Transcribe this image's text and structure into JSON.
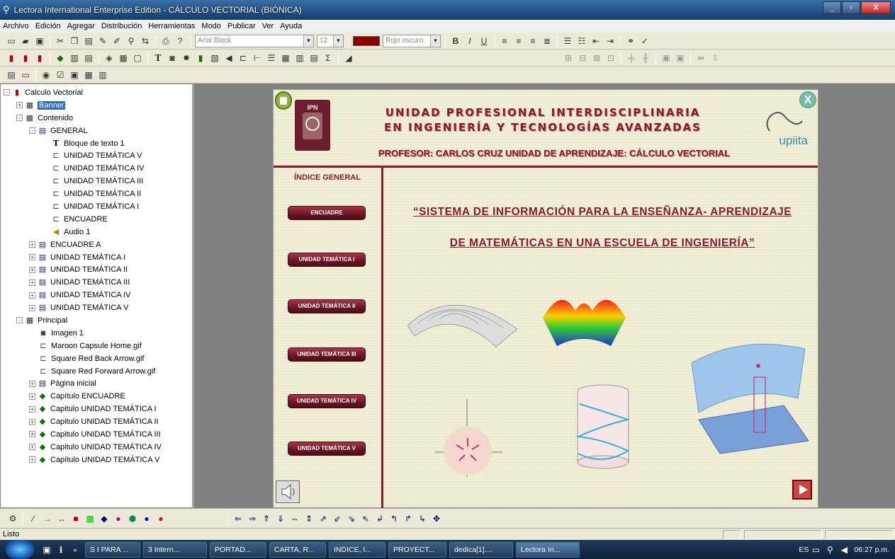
{
  "window": {
    "title": "Lectora International Enterprise Edition - CÁLCULO  VECTORIAL (BIÓNICA)"
  },
  "menu": [
    "Archivo",
    "Edición",
    "Agregar",
    "Distribución",
    "Herramientas",
    "Modo",
    "Publicar",
    "Ver",
    "Ayuda"
  ],
  "toolbar": {
    "font": "Arial Black",
    "size": "12",
    "color_name": "Rojo oscuro",
    "color": "#8b0000"
  },
  "tree": [
    {
      "label": "Calculo Vectorial",
      "level": 0,
      "icon": "book-icon",
      "exp": "-"
    },
    {
      "label": "Banner",
      "level": 1,
      "icon": "frame-icon",
      "exp": "+",
      "selected": true
    },
    {
      "label": "Contenido",
      "level": 1,
      "icon": "frame-icon",
      "exp": "-"
    },
    {
      "label": "GENERAL",
      "level": 2,
      "icon": "page-icon",
      "exp": "-"
    },
    {
      "label": "Bloque de texto 1",
      "level": 3,
      "icon": "text-icon"
    },
    {
      "label": "UNIDAD TEMÁTICA V",
      "level": 3,
      "icon": "button-icon"
    },
    {
      "label": "UNIDAD TEMÁTICA IV",
      "level": 3,
      "icon": "button-icon"
    },
    {
      "label": "UNIDAD TEMÁTICA III",
      "level": 3,
      "icon": "button-icon"
    },
    {
      "label": "UNIDAD TEMÁTICA II",
      "level": 3,
      "icon": "button-icon"
    },
    {
      "label": "UNIDAD TEMÁTICA I",
      "level": 3,
      "icon": "button-icon"
    },
    {
      "label": "ENCUADRE",
      "level": 3,
      "icon": "button-icon"
    },
    {
      "label": "Audio 1",
      "level": 3,
      "icon": "audio-icon"
    },
    {
      "label": "ENCUADRE A",
      "level": 2,
      "icon": "page-icon",
      "exp": "+"
    },
    {
      "label": "UNIDAD TEMÁTICA I",
      "level": 2,
      "icon": "page-icon",
      "exp": "+"
    },
    {
      "label": "UNIDAD TEMÁTICA II",
      "level": 2,
      "icon": "page-icon",
      "exp": "+"
    },
    {
      "label": "UNIDAD TEMÁTICA III",
      "level": 2,
      "icon": "page-icon",
      "exp": "+"
    },
    {
      "label": "UNIDAD TEMÁTICA IV",
      "level": 2,
      "icon": "page-icon",
      "exp": "+"
    },
    {
      "label": "UNIDAD TEMÁTICA V",
      "level": 2,
      "icon": "page-icon",
      "exp": "+"
    },
    {
      "label": "Principal",
      "level": 1,
      "icon": "frame-icon",
      "exp": "-"
    },
    {
      "label": "Imagen 1",
      "level": 2,
      "icon": "image-icon"
    },
    {
      "label": "Maroon Capsule Home.gif",
      "level": 2,
      "icon": "button-icon"
    },
    {
      "label": "Square Red Back Arrow.gif",
      "level": 2,
      "icon": "button-icon"
    },
    {
      "label": "Square Red  Forward Arrow.gif",
      "level": 2,
      "icon": "button-icon"
    },
    {
      "label": "Página inicial",
      "level": 2,
      "icon": "page-icon",
      "exp": "+"
    },
    {
      "label": "Capítulo ENCUADRE",
      "level": 2,
      "icon": "chapter-icon",
      "exp": "+"
    },
    {
      "label": "Capitulo UNIDAD TEMÁTICA I",
      "level": 2,
      "icon": "chapter-icon",
      "exp": "+"
    },
    {
      "label": "Capitulo UNIDAD TEMÁTICA II",
      "level": 2,
      "icon": "chapter-icon",
      "exp": "+"
    },
    {
      "label": "Capitulo UNIDAD TEMÁTICA III",
      "level": 2,
      "icon": "chapter-icon",
      "exp": "+"
    },
    {
      "label": "Capitulo UNIDAD TEMÁTICA IV",
      "level": 2,
      "icon": "chapter-icon",
      "exp": "+"
    },
    {
      "label": "Capítulo UNIDAD TEMÁTICA V",
      "level": 2,
      "icon": "chapter-icon",
      "exp": "+"
    }
  ],
  "page": {
    "header_line1": "UNIDAD PROFESIONAL INTERDISCIPLINARIA",
    "header_line2": "EN INGENIERÍA Y TECNOLOGÍAS AVANZADAS",
    "professor": "PROFESOR:  CARLOS CRUZ    UNIDAD  DE  APRENDIZAJE:   CÁLCULO VECTORIAL",
    "seal": "IPN",
    "logo": "upiita",
    "index_title": "ÍNDICE GENERAL",
    "nav_buttons": [
      "ENCUADRE",
      "UNIDAD TEMÁTICA I",
      "UNIDAD TEMÁTICA II",
      "UNIDAD TEMÁTICA III",
      "UNIDAD TEMÁTICA IV",
      "UNIDAD TEMÁTICA V"
    ],
    "title_line1": "“SISTEMA  DE  INFORMACIÓN PARA LA ENSEÑANZA- APRENDIZAJE",
    "title_line2": "DE MATEMÁTICAS   EN   UNA   ESCUELA   DE   INGENIERÍA”",
    "close_label": "X"
  },
  "status": {
    "text": "Listo"
  },
  "taskbar": {
    "tasks": [
      "S I PARA ...",
      "3 Intern...",
      "PORTAD...",
      "CARTA, R...",
      "INDICE, I...",
      "PROYECT...",
      "dedica[1]....",
      "Lectora In..."
    ],
    "lang": "ES",
    "clock": "06:27 p.m."
  }
}
